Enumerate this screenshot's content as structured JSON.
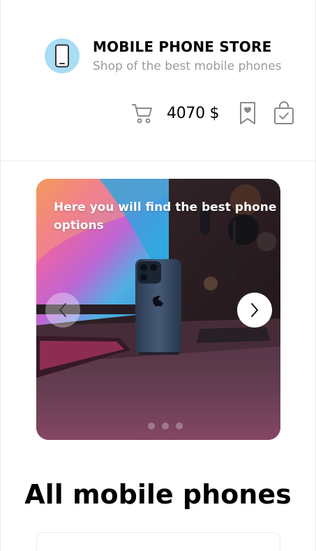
{
  "store": {
    "title": "MOBILE PHONE STORE",
    "subtitle": "Shop of the best mobile phones",
    "logo_icon": "phone-icon",
    "logo_bg": "#a9dcf5"
  },
  "header_actions": {
    "cart_icon": "cart-icon",
    "cart_total": "4070 $",
    "bookmark_icon": "bookmark-heart-icon",
    "bag_icon": "shopping-bag-check-icon"
  },
  "carousel": {
    "caption": "Here you will find the best phone options",
    "prev_icon": "chevron-left-icon",
    "next_icon": "chevron-right-icon",
    "slide_count": 3,
    "active_slide": 0
  },
  "section": {
    "title": "All mobile phones"
  }
}
